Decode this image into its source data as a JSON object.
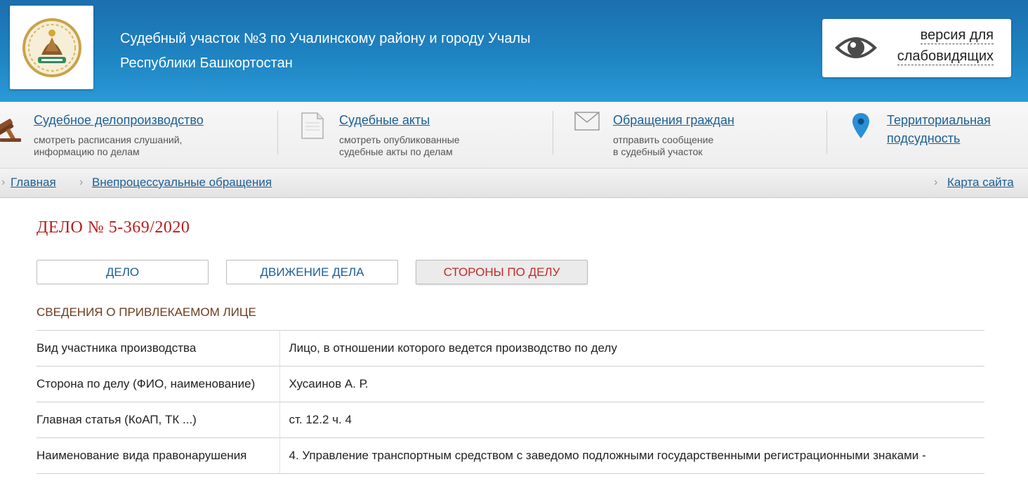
{
  "header": {
    "title_line1": "Судебный участок №3 по Учалинскому району и городу Учалы",
    "title_line2": "Республики Башкортостан",
    "eye_line1": "версия для",
    "eye_line2": "слабовидящих"
  },
  "nav": [
    {
      "title": "Судебное делопроизводство",
      "sub1": "смотреть расписания слушаний,",
      "sub2": "информацию по делам",
      "icon": "gavel-icon"
    },
    {
      "title": "Судебные акты",
      "sub1": "смотреть опубликованные",
      "sub2": "судебные акты по делам",
      "icon": "document-icon"
    },
    {
      "title": "Обращения граждан",
      "sub1": "отправить сообщение",
      "sub2": "в судебный участок",
      "icon": "envelope-icon"
    },
    {
      "title1": "Территориальная",
      "title2": "подсудность",
      "icon": "map-pin-icon"
    }
  ],
  "breadcrumb": {
    "home": "Главная",
    "current": "Внепроцессуальные обращения",
    "sitemap": "Карта сайта"
  },
  "case": {
    "title": "ДЕЛО № 5-369/2020",
    "tabs": [
      "ДЕЛО",
      "ДВИЖЕНИЕ ДЕЛА",
      "СТОРОНЫ ПО ДЕЛУ"
    ],
    "active_tab": "СТОРОНЫ ПО ДЕЛУ",
    "section_heading": "СВЕДЕНИЯ О ПРИВЛЕКАЕМОМ ЛИЦЕ",
    "rows": [
      {
        "k": "Вид участника производства",
        "v": "Лицо, в отношении которого ведется производство по делу"
      },
      {
        "k": "Сторона по делу (ФИО, наименование)",
        "v": "Хусаинов А. Р."
      },
      {
        "k": "Главная статья (КоАП, ТК ...)",
        "v": "ст. 12.2 ч. 4"
      },
      {
        "k": "Наименование вида правонарушения",
        "v": "4. Управление транспортным средством с заведомо подложными государственными регистрационными знаками -"
      }
    ]
  },
  "colors": {
    "header": "#1f86c4",
    "link": "#1c5e96",
    "accent_red": "#b71c1c"
  }
}
